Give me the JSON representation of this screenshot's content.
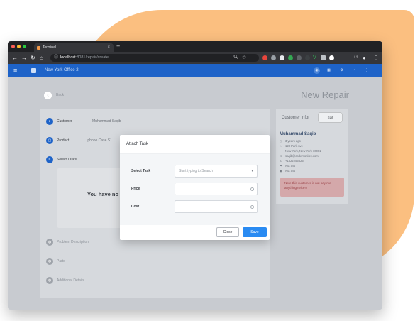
{
  "browser": {
    "tab_title": "Terminal",
    "tab_close": "×",
    "new_tab": "+",
    "url_host": "localhost",
    "url_path": ":8081/repair/create"
  },
  "app": {
    "menu_icon": "≡",
    "store_name": "New York Office 2"
  },
  "page": {
    "back_label": "Back",
    "title": "New Repair"
  },
  "steps": [
    {
      "label": "Customer",
      "value": "Muhammad Saqib",
      "color": "#1e63c8"
    },
    {
      "label": "Product",
      "value": "Iphone Case S1",
      "color": "#1e63c8"
    },
    {
      "label": "Select Tasks",
      "value": "",
      "color": "#1e63c8"
    },
    {
      "label": "Problem Description",
      "value": "",
      "color": "#9ea3aa"
    },
    {
      "label": "Parts",
      "value": "",
      "color": "#9ea3aa"
    },
    {
      "label": "Additional Details",
      "value": "",
      "color": "#9ea3aa"
    }
  ],
  "empty_tasks_text": "You have no",
  "customer_info": {
    "title": "Customer infor",
    "edit_label": "Edit",
    "name": "Muhammad Saqib",
    "rows": [
      {
        "icon": "◷",
        "text": "3 years ago"
      },
      {
        "icon": "⌂",
        "text": "123 Park Ave"
      },
      {
        "icon": " ",
        "text": "New York, New York 10001"
      },
      {
        "icon": "✉",
        "text": "saqib@codemonkey.com"
      },
      {
        "icon": "✆",
        "text": "+1522255625"
      },
      {
        "icon": "⚑",
        "text": "Not Set"
      },
      {
        "icon": "▣",
        "text": "Not Set"
      }
    ],
    "note": "Note this customer is not pay me anything twice!!!"
  },
  "modal": {
    "title": "Attach Task",
    "select_task_label": "Select Task",
    "select_task_placeholder": "Start typing to Search",
    "price_label": "Price",
    "price_value": "0",
    "cost_label": "Cost",
    "cost_value": "0",
    "close_label": "Close",
    "save_label": "Save"
  }
}
